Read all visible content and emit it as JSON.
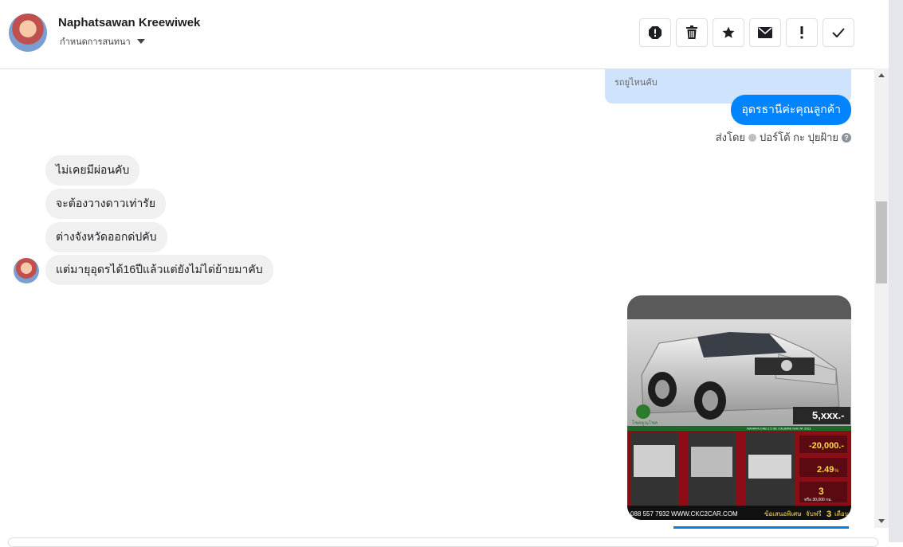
{
  "header": {
    "contact_name": "Naphatsawan Kreewiwek",
    "assign_label": "กำหนดการสนทนา",
    "toolbar": [
      {
        "icon": "report-icon",
        "label": "Report"
      },
      {
        "icon": "trash-icon",
        "label": "Delete"
      },
      {
        "icon": "star-icon",
        "label": "Star"
      },
      {
        "icon": "mail-icon",
        "label": "Mark unread"
      },
      {
        "icon": "exclamation-icon",
        "label": "Spam"
      },
      {
        "icon": "checkmark-icon",
        "label": "Done"
      }
    ]
  },
  "conversation": {
    "quoted_reply": "รถยูไหนคับ",
    "outgoing_message": "อุดรธานีค่ะคุณลูกค้า",
    "sent_by_label": "ส่งโดย",
    "sent_by_name": "ปอร์โต้ กะ ปุยฝ้าย",
    "incoming_messages": [
      "ไม่เคยมีผ่อนคับ",
      "จะต้องวางดาวเท่ารัย",
      "ต่างจังหวัดออกด่ปคับ",
      "แต่มายุอุดรได้16ปีแล้วแต่ยังไม่ได่ย้ายมาคับ"
    ],
    "image_ad": {
      "price_main": "5,xxx.-",
      "discount": "-20,000.-",
      "rate": "2.49",
      "rate_unit": "%",
      "warranty_years": "3",
      "warranty_note": "หรือ 30,000 กม.",
      "phone_web": "088 557 7932 WWW.CKC2CAR.COM",
      "promo_left": "ข้อเสนอพิเศษ",
      "promo_right_prefix": "จับฟรี",
      "promo_months": "3",
      "promo_right_suffix": "เดือน",
      "logo_text": "โชคคูณโชค",
      "model_text": "NAVARA CAB 2.5 SE CALIBRE NAV AT 2011"
    }
  },
  "colors": {
    "outgoing_bubble": "#0084ff",
    "incoming_bubble": "#f0f0f0",
    "quote_bg": "#cfe3fc",
    "ad_red": "#8b0d16"
  }
}
